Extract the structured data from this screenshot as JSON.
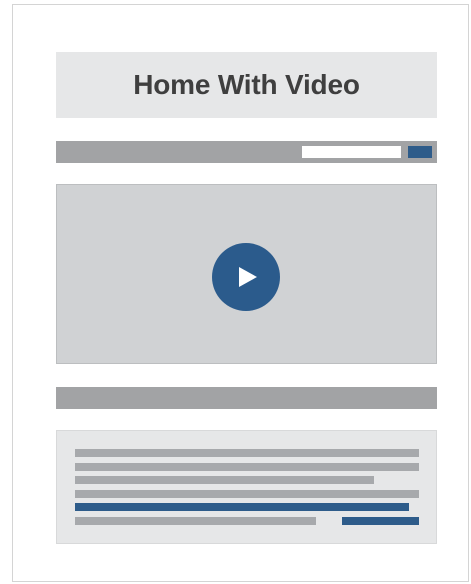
{
  "page": {
    "title": "Home With Video"
  },
  "icons": {
    "play": "play-icon"
  },
  "colors": {
    "accent": "#2e5c8a",
    "bar_gray": "#a2a3a5",
    "panel_light": "#e6e7e8",
    "video_bg": "#d0d2d4",
    "title_text": "#3f3f3f"
  }
}
